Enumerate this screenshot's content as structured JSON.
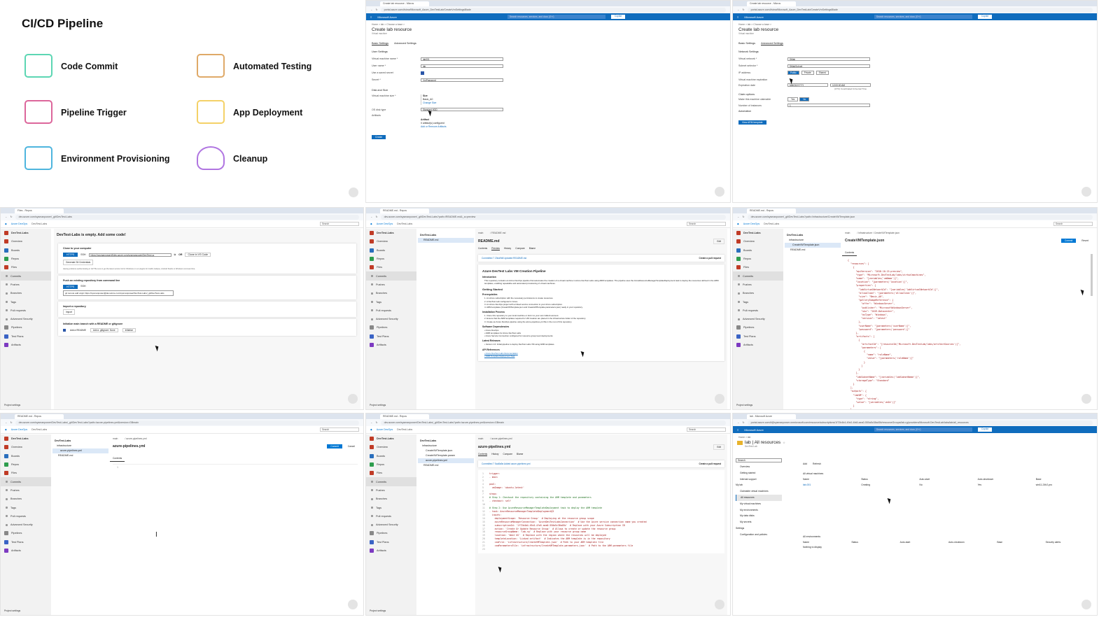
{
  "slide": {
    "title": "CI/CD Pipeline",
    "items": [
      {
        "label": "Code Commit",
        "icon": "keyboard-icon",
        "color": "#3fcfa6"
      },
      {
        "label": "Automated Testing",
        "icon": "table-icon",
        "color": "#d99a4e"
      },
      {
        "label": "Pipeline Trigger",
        "icon": "book-icon",
        "color": "#d64b8a"
      },
      {
        "label": "App Deployment",
        "icon": "gear-progress-icon",
        "color": "#f2c94c"
      },
      {
        "label": "Environment Provisioning",
        "icon": "monitor-code-icon",
        "color": "#2fa8d8"
      },
      {
        "label": "Cleanup",
        "icon": "meditation-icon",
        "color": "#a25ddc"
      }
    ]
  },
  "azure": {
    "brand": "Microsoft Azure",
    "search": "Search resources, services, and docs (G+/)",
    "copilot": "Copilot",
    "accent": "#0f6cbd"
  },
  "devops": {
    "brand": "Azure DevOps",
    "search": "Search",
    "project": "DevTest-Labs",
    "nav": [
      "Overview",
      "Boards",
      "Repos",
      "Files",
      "Commits",
      "Pushes",
      "Branches",
      "Tags",
      "Pull requests",
      "Advanced Security",
      "Pipelines",
      "Test Plans",
      "Artifacts"
    ],
    "settings": "Project settings"
  },
  "create_basic": {
    "tab": "Create lab resource - Micros",
    "url": "portal.azure.com/#view/Microsoft_Azure_DevTestLab/CreateVmSettingsBlade",
    "crumb": "Home > lab > Choose a base >",
    "title": "Create lab resource",
    "subtitle": "Virtual machine",
    "tabs": [
      "Basic Settings",
      "Advanced Settings"
    ],
    "section": "User Settings",
    "fields": [
      {
        "label": "Virtual machine name *",
        "value": "lab001"
      },
      {
        "label": "User name *",
        "value": "lab"
      },
      {
        "label": "Use a saved secret",
        "value": ""
      },
      {
        "label": "Secret *",
        "value": "VmPassword"
      }
    ],
    "section2": "Disk and Size",
    "size_label": "Virtual machine size *",
    "size_lines": [
      "Size",
      "Basic_A0",
      "Change Size"
    ],
    "os_label": "OS disk type",
    "os_value": "Standard HDD",
    "artifacts_label": "Artifacts",
    "artifacts_lines": [
      "Artifact",
      "0 artifact(s) configured",
      "Add or Remove Artifacts"
    ],
    "create": "Create"
  },
  "create_adv": {
    "crumb": "Home > lab > Choose a base >",
    "title": "Create lab resource",
    "subtitle": "Virtual machine",
    "section": "Network Settings",
    "fields": [
      {
        "label": "Virtual network *",
        "value": "Dtllab"
      },
      {
        "label": "Subnet selector *",
        "value": "DtllabSubnet"
      }
    ],
    "ip_label": "IP address",
    "ip_opts": [
      "Public",
      "Private",
      "Shared"
    ],
    "exp_label": "Virtual machine expiration",
    "exp_date_label": "Expiration date",
    "exp_date": "MM/DD/YYYY",
    "exp_time": "12:00:00 AM",
    "tz": "(UTC) Coordinated Universal Time",
    "claim_section": "Claim options",
    "claim_label": "Make this machine claimable",
    "claim_opts": [
      "Yes",
      "No"
    ],
    "inst_label": "Number of instances",
    "inst_value": "1",
    "automation": "Automation",
    "arm_btn": "View ARM template"
  },
  "empty_repo": {
    "tab": "Files - Repos",
    "url": "dev.azure.com/sysmanpower/_git/DevTest-Labs",
    "heading": "DevTest-Labs is empty. Add some code!",
    "clone_title": "Clone to your computer",
    "https": "HTTPS",
    "ssh": "SSH",
    "clone_url": "https://sysmanpower@dev.azure.com/sysmanpower/DevTest-La",
    "or": "OR",
    "vscode": "Clone in VS Code",
    "gen_creds": "Generate Git Credentials",
    "hint": "Having problems authenticating in Git? Be sure to get the latest version Git for Windows or our plugins for IntelliJ, Eclipse, Android Studio or Windows command line.",
    "push_title": "Push an existing repository from command line",
    "push_cmd": "git remote add origin https://sysmanpower@dev.azure.com/sysmanpower/DevTest-Labs/_git/DevTest-Labs",
    "import_title": "Import a repository",
    "import_btn": "Import",
    "init_title": "Initialize main branch with a README or gitignore",
    "add_readme": "Add a README",
    "gitignore": "Add a .gitignore: None",
    "init_btn": "Initialize"
  },
  "readme": {
    "tab": "README.md - Repos",
    "url": "dev.azure.com/sysmanpower/_git/DevTest-Labs?path=/README.md&_a=preview",
    "branch": "main",
    "path": "/ README.md",
    "file": "README.md",
    "edit": "Edit",
    "tabs": [
      "Contents",
      "Preview",
      "History",
      "Compare",
      "Blame"
    ],
    "commit": "Committed 7 23ea9b8 Updated README.md",
    "pr": "Create a pull request",
    "tree": [
      "DevTest-Labs",
      "README.md"
    ],
    "doc": [
      {
        "h": "Azure DevTest Labs VM Creation Pipeline",
        "t": "h1"
      },
      {
        "h": "Introduction",
        "t": "h3"
      },
      {
        "h": "This repository contains an Azure DevOps pipeline that automates the creation of a virtual machine in Azure DevTest Labs using ARM templates. The pipeline uses the AzureResourceManagerTemplateDeployment task to deploy the resources defined in the ARM templates, enabling repeatable and automated provisioning of virtual machines.",
        "t": "p"
      },
      {
        "h": "Getting Started",
        "t": "h2"
      },
      {
        "h": "Prerequisites",
        "t": "h3"
      },
      {
        "h": "1. An Azure subscription with the necessary permissions to create resources.",
        "t": "p"
      },
      {
        "h": "2. A DevTest Lab configured in Azure.",
        "t": "p"
      },
      {
        "h": "3. An Azure DevOps project with a linked service connection to your Azure subscription.",
        "t": "p"
      },
      {
        "h": "4. ARM templates (CreateVMTemplate.json and CreateVMTemplate.parameters.json) ready in your repository.",
        "t": "p"
      },
      {
        "h": "Installation Process",
        "t": "h3"
      },
      {
        "h": "1. Clone this repository to your local machine or fork it to your own GitHub account.",
        "t": "p"
      },
      {
        "h": "2. Ensure that the ARM templates required for VM creation are placed in the infrastructure folder of the repository.",
        "t": "p"
      },
      {
        "h": "3. Create an Azure DevOps pipeline using the azure-pipelines.yml file in the root of this repository.",
        "t": "p"
      },
      {
        "h": "Software Dependencies",
        "t": "h3"
      },
      {
        "h": "• Azure DevOps",
        "t": "p"
      },
      {
        "h": "• ARM templates for Azure DevTest Labs",
        "t": "p"
      },
      {
        "h": "• Azure Service Connection configured for resource group level deployments",
        "t": "p"
      },
      {
        "h": "Latest Releases",
        "t": "h3"
      },
      {
        "h": "• Version 1.0: Initial pipeline to deploy DevTest Labs VM using ARM templates.",
        "t": "p"
      },
      {
        "h": "API References",
        "t": "h3"
      },
      {
        "h": "• Azure DevTest Labs Documentation",
        "t": "a"
      },
      {
        "h": "• ARM Template Deployment Task",
        "t": "a"
      }
    ]
  },
  "template": {
    "url": "dev.azure.com/sysmanpower/_git/DevTest-Labs?path=/infrastructure/CreateVMTemplate.json",
    "branch": "main",
    "path": "/ infrastructure / CreateVMTemplate.json",
    "file": "CreateVMTemplate.json",
    "commit_btn": "Commit",
    "revert": "Revert",
    "tab": "Contents",
    "tree": [
      "DevTest-Labs",
      "infrastructure",
      "CreateVMTemplate.json",
      "README.md"
    ],
    "code": [
      "{",
      "  \"resources\": [",
      "    {",
      "      \"apiVersion\": \"2018-10-15-preview\",",
      "      \"type\": \"Microsoft.DevTestLab/labs/virtualmachines\",",
      "      \"name\": \"[variables('vmName')]\",",
      "      \"location\": \"[parameters('location')]\",",
      "      \"properties\": {",
      "        \"labVirtualNetworkId\": \"[variables('labVirtualNetworkId')]\",",
      "        \"allowClaim\": \"[parameters('allowClaim')]\",",
      "        \"size\": \"Basic_A0\",",
      "        \"galleryImageReference\": {",
      "          \"offer\": \"WindowsServer\",",
      "          \"publisher\": \"MicrosoftWindowsServer\",",
      "          \"sku\": \"2019-Datacenter\",",
      "          \"osType\": \"Windows\",",
      "          \"version\": \"latest\"",
      "        },",
      "        \"userName\": \"[parameters('userName')]\",",
      "        \"password\": \"[parameters('password')]\"",
      "      },",
      "      \"artifacts\": [",
      "        {",
      "          \"artifactId\": \"[resourceId('Microsoft.DevTestLab/labs/artifactSources')]\",",
      "          \"parameters\": [",
      "            {",
      "              \"name\": \"roleName\",",
      "              \"value\": \"[parameters('roleName')]\"",
      "            }",
      "          ]",
      "        }",
      "      ],",
      "      \"labSubnetName\": \"[variables('labSubnetName')]\",",
      "      \"storageType\": \"Standard\"",
      "    }",
      "  ],",
      "  \"outputs\": {",
      "    \"labVM\": {",
      "      \"type\": \"string\",",
      "      \"value\": \"[variables('vmId')]\"",
      "    }",
      "  }",
      "}"
    ]
  },
  "pipeline_edit": {
    "url": "dev.azure.com/sysmanpower/DevTest-Labs/_git/DevTest-Labs?path=/azure-pipelines.yml&version=GBmain",
    "branch": "main",
    "path": "/ azure-pipelines.yml",
    "file": "azure-pipelines.yml",
    "commit_btn": "Commit",
    "cancel": "Cancel",
    "tab": "Contents",
    "line": "1",
    "tree": [
      "DevTest-Labs",
      "infrastructure",
      "azure-pipelines.yml",
      "README.md"
    ]
  },
  "pipeline_view": {
    "branch": "main",
    "path": "/ azure-pipelines.yml",
    "file": "azure-pipelines.yml",
    "edit": "Edit",
    "tabs": [
      "Contents",
      "History",
      "Compare",
      "Blame"
    ],
    "commit": "Committed 7 5ca8a9a Added azure-pipelines.yml",
    "pr": "Create a pull request",
    "tree": [
      "DevTest-Labs",
      "infrastructure",
      "CreateVMTemplate.json",
      "CreateVMTemplate.param",
      "azure-pipelines.yml",
      "README.md"
    ],
    "code": [
      "trigger:",
      "- main",
      "",
      "pool:",
      "  vmImage: 'ubuntu-latest'",
      "",
      "steps:",
      "# Step 1: Checkout the repository containing the ARM template and parameters",
      "- checkout: self",
      "",
      "# Step 2: Use AzureResourceManagerTemplateDeployment task to deploy the ARM template",
      "- task: AzureResourceManagerTemplateDeployment@3",
      "  inputs:",
      "    deploymentScope: 'Resource Group'  # Deploying at the resource group scope",
      "    azureResourceManagerConnection: 'AzureDevTestLabsConnection'  # Use the Azure service connection name you created",
      "    subscriptionId: '1f72b4b4-49c0-4fa5-aea0-550a5c38a45b'  # Replace with your Azure Subscription ID",
      "    action: 'Create Or Update Resource Group'  # Allows to create or update the resource group",
      "    resourceGroupName: 'lab-rg'  # Replace with your resource group name",
      "    location: 'West US'  # Replace with the region where the resources will be deployed",
      "    templateLocation: 'Linked artifact'  # Indicates the ARM template is in the repository",
      "    csmFile: 'infrastructure/CreateVMTemplate.json'  # Path to your ARM template file",
      "    csmParametersFile: 'infrastructure/CreateVMTemplate.parameters.json'  # Path to the ARM parameters file",
      ""
    ]
  },
  "lab": {
    "tab": "lab - Microsoft Azure",
    "url": "portal.azure.com/#@sysmanpower.onmicrosoft.com/resource/subscriptions/1f72b4b4-49c0-4fa5-aea0-550a5c38a45b/resourceGroups/lab-rg/providers/Microsoft.DevTestLab/labs/lab/all_resources",
    "crumb": "Home > lab",
    "title": "lab | All resources",
    "subtitle": "DevTest Lab",
    "search": "Search",
    "add": "Add",
    "refresh": "Refresh",
    "menu": [
      {
        "label": "Overview"
      },
      {
        "label": "Getting started"
      },
      {
        "label": "Internal support"
      },
      {
        "label": "My lab",
        "group": true
      },
      {
        "label": "Claimable virtual machines"
      },
      {
        "label": "All resources",
        "selected": true
      },
      {
        "label": "My virtual machines"
      },
      {
        "label": "My environments"
      },
      {
        "label": "My data disks"
      },
      {
        "label": "My secrets"
      },
      {
        "label": "Settings",
        "group": true
      },
      {
        "label": "Configuration and policies"
      }
    ],
    "vm_section": "All virtual machines",
    "vm_cols": [
      "Name",
      "Status",
      "Auto-start",
      "Auto-shutdown",
      "Base"
    ],
    "vm_rows": [
      [
        "lab-001",
        "Creating",
        "No",
        "Yes",
        "win11-24h2-pro"
      ]
    ],
    "env_section": "All environments",
    "env_cols": [
      "Name",
      "Status",
      "Auto-start",
      "Auto-shutdown",
      "Base",
      "Security alerts"
    ],
    "env_empty": "Nothing to display"
  }
}
